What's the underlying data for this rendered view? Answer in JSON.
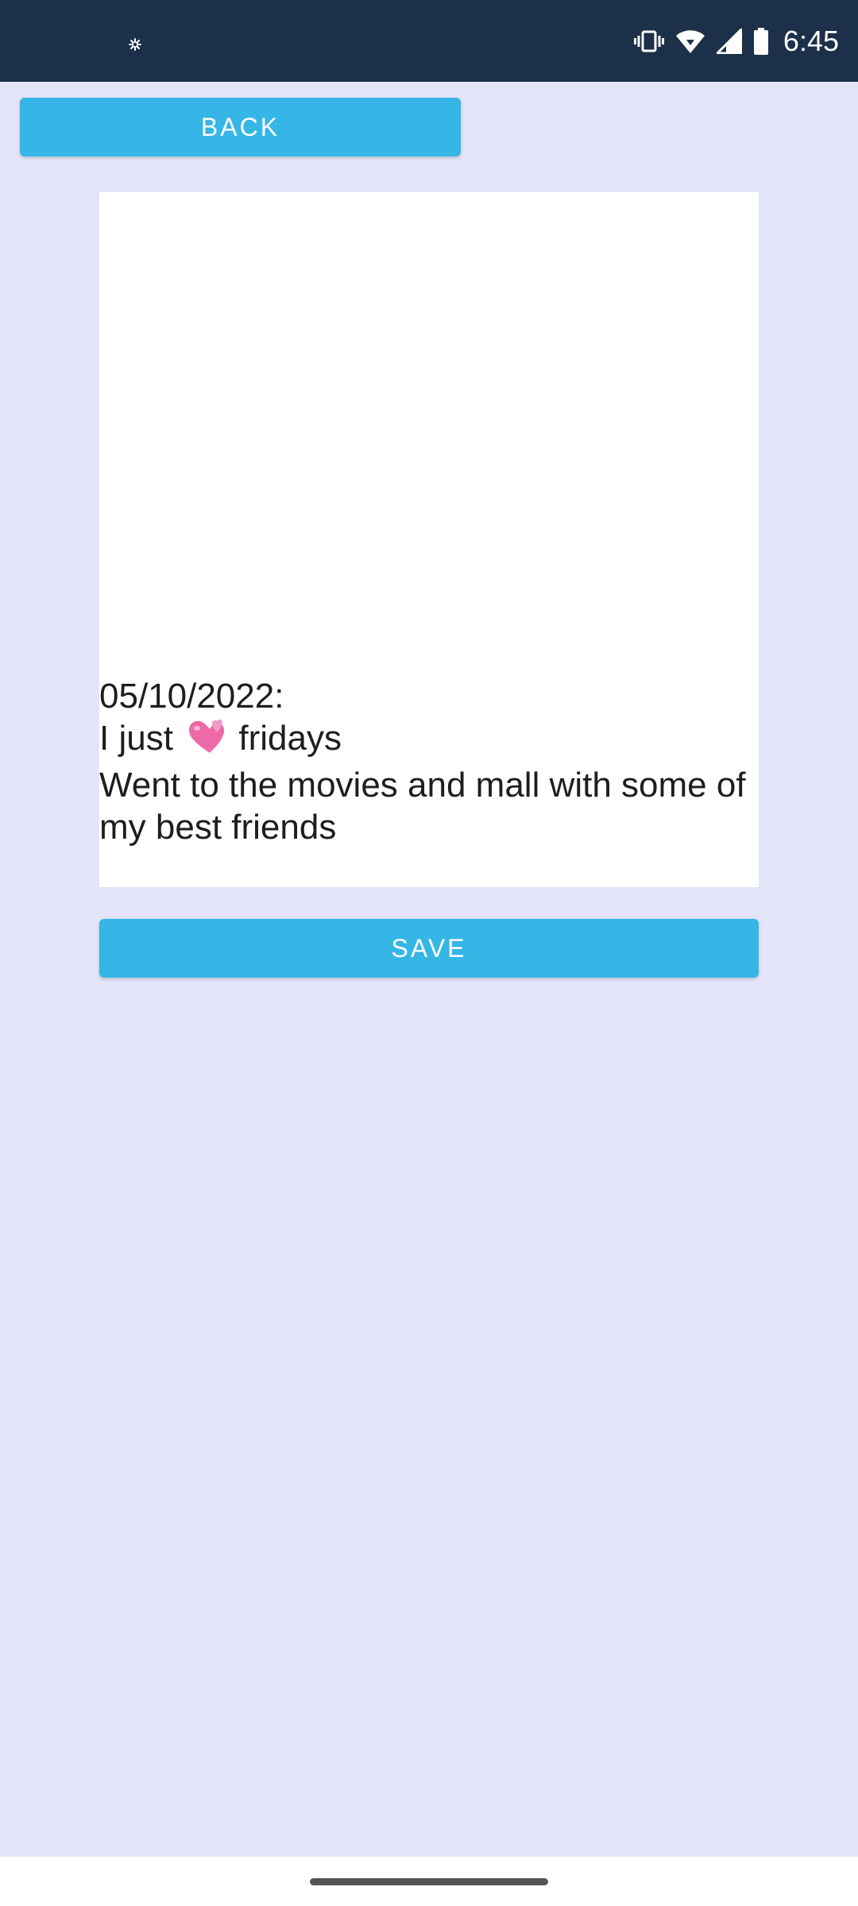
{
  "status_bar": {
    "time": "6:45",
    "icons": [
      "app-notification-icon",
      "vibrate-icon",
      "wifi-icon",
      "signal-icon",
      "battery-icon"
    ]
  },
  "toolbar": {
    "back_label": "BACK"
  },
  "entry": {
    "date_line": "05/10/2022:",
    "line2_before": "I just ",
    "line2_emoji": "two-hearts-emoji",
    "line2_after": " fridays",
    "line3": "Went to the movies and mall with some of my best friends"
  },
  "actions": {
    "save_label": "SAVE"
  },
  "colors": {
    "status_bar_bg": "#1c3049",
    "page_bg": "#e4e4f8",
    "button_bg": "#35b6e6",
    "entry_bg": "#ffffff"
  }
}
